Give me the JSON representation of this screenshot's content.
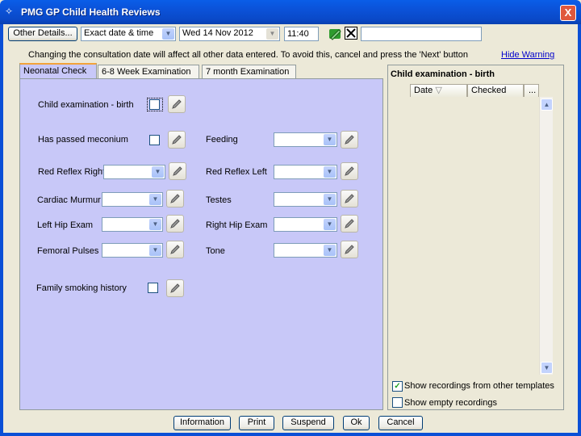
{
  "window": {
    "title": "PMG GP Child Health Reviews",
    "close": "X"
  },
  "toolbar": {
    "other_details": "Other Details...",
    "date_mode": "Exact date & time",
    "date": "Wed 14 Nov 2012",
    "time": "11:40",
    "free_text": ""
  },
  "warning": {
    "text": "Changing the consultation date will affect all other data entered. To avoid this, cancel and press the 'Next' button",
    "link": "Hide Warning"
  },
  "tabs": [
    "Neonatal Check",
    "6-8 Week Examination",
    "7 month Examination"
  ],
  "form": {
    "child_exam": "Child examination - birth",
    "meconium": "Has passed meconium",
    "feeding": "Feeding",
    "red_reflex_right": "Red Reflex Right",
    "red_reflex_left": "Red Reflex Left",
    "cardiac_murmur": "Cardiac Murmur",
    "testes": "Testes",
    "left_hip": "Left Hip Exam",
    "right_hip": "Right Hip Exam",
    "femoral_pulses": "Femoral Pulses",
    "tone": "Tone",
    "family_smoking": "Family smoking history"
  },
  "right_panel": {
    "title": "Child examination - birth",
    "col_date": "Date",
    "col_checked": "Checked",
    "col_more": "...",
    "show_other": "Show recordings from other templates",
    "show_empty": "Show empty recordings",
    "show_other_checked": true,
    "show_empty_checked": false
  },
  "footer": {
    "information": "Information",
    "print": "Print",
    "suspend": "Suspend",
    "ok": "Ok",
    "cancel": "Cancel"
  }
}
